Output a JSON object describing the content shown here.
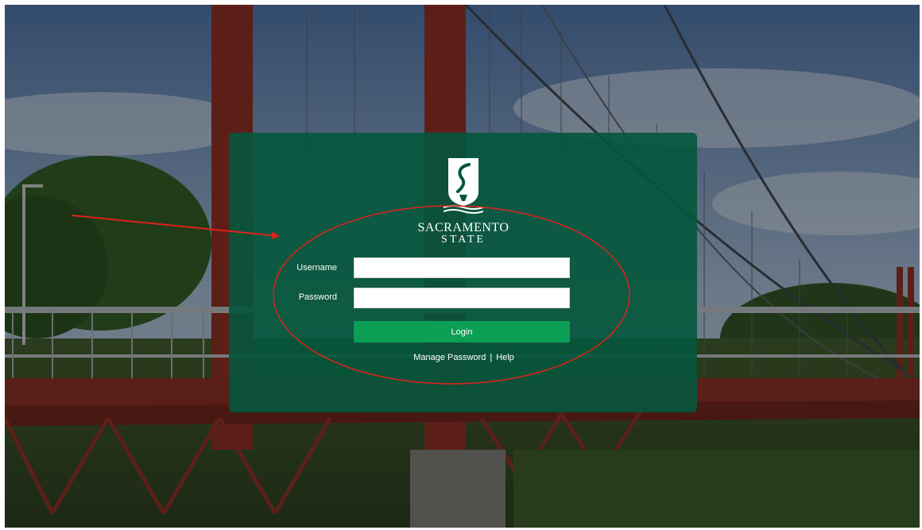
{
  "logo": {
    "icon": "sacramento-state-torch-icon",
    "line1": "SACRAMENTO",
    "line2": "STATE"
  },
  "form": {
    "username_label": "Username",
    "username_value": "",
    "password_label": "Password",
    "password_value": "",
    "login_label": "Login"
  },
  "links": {
    "manage_password": "Manage Password",
    "separator": "|",
    "help": "Help"
  },
  "colors": {
    "panel": "#04563c",
    "button": "#0d9e55",
    "annotation": "#e0211c",
    "bridge": "#9b2b22"
  }
}
